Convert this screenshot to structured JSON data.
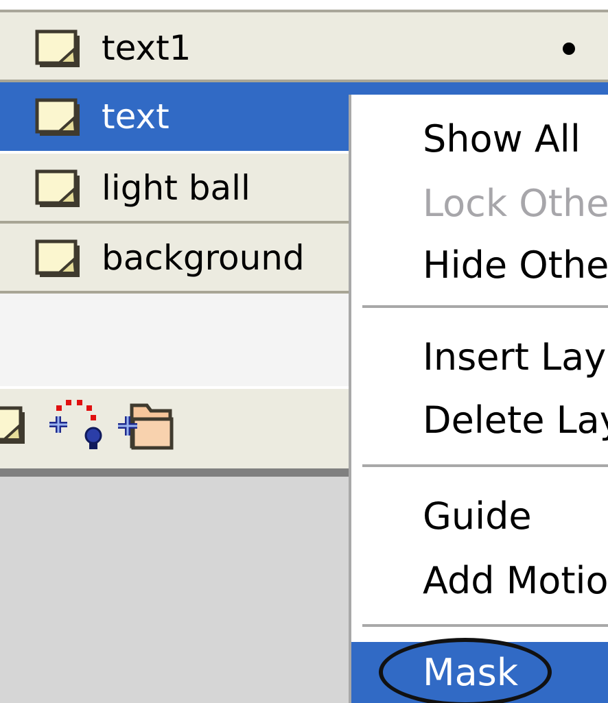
{
  "layers": [
    {
      "name": "text1",
      "selected": false,
      "visible_dot": true
    },
    {
      "name": "text",
      "selected": true,
      "visible_dot": false
    },
    {
      "name": "light ball",
      "selected": false,
      "visible_dot": false
    },
    {
      "name": "background",
      "selected": false,
      "visible_dot": false
    }
  ],
  "toolbar": {
    "icons": [
      "layer-icon",
      "add-motion-guide-icon",
      "insert-layer-folder-icon"
    ]
  },
  "context_menu": {
    "items": [
      {
        "label": "Show All",
        "enabled": true
      },
      {
        "label": "Lock Other",
        "enabled": false
      },
      {
        "label": "Hide Other",
        "enabled": true
      },
      {
        "label": "Insert Lay",
        "enabled": true
      },
      {
        "label": "Delete Lay",
        "enabled": true
      },
      {
        "label": "Guide",
        "enabled": true
      },
      {
        "label": "Add Motion",
        "enabled": true
      },
      {
        "label": "Mask",
        "enabled": true,
        "highlighted": true
      }
    ]
  },
  "colors": {
    "selection": "#316ac5",
    "panel": "#ecebe0",
    "disabled_text": "#a7a6aa"
  }
}
